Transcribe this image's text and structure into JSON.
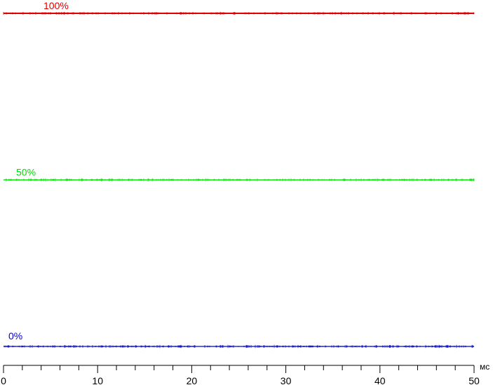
{
  "chart_data": {
    "type": "line",
    "title": "",
    "xlabel": "",
    "ylabel": "",
    "x_unit": "мс",
    "xlim": [
      0,
      50
    ],
    "ylim": [
      0,
      100
    ],
    "x_ticks": [
      "0",
      "10",
      "20",
      "30",
      "40",
      "50"
    ],
    "x_minor_step": 2,
    "grid": false,
    "legend": "none",
    "series": [
      {
        "name": "100%",
        "level": 100,
        "color": "#dd0000",
        "values": [
          [
            0,
            100
          ],
          [
            50,
            100
          ]
        ]
      },
      {
        "name": "50%",
        "level": 50,
        "color": "#00dd00",
        "values": [
          [
            0,
            50
          ],
          [
            50,
            50
          ]
        ]
      },
      {
        "name": "0%",
        "level": 0,
        "color": "#0000cc",
        "values": [
          [
            0,
            0
          ],
          [
            50,
            0
          ]
        ]
      }
    ]
  }
}
